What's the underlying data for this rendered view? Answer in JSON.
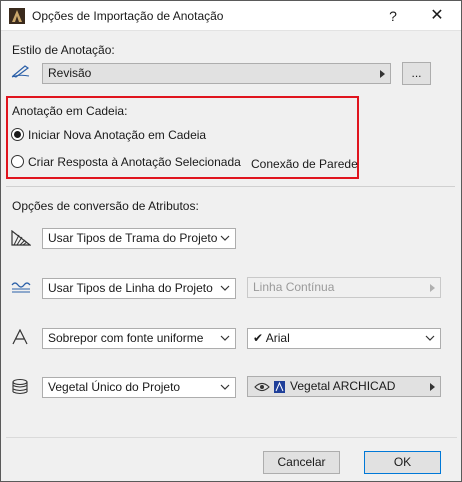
{
  "window": {
    "title": "Opções de Importação de Anotação",
    "help": "?",
    "close": "✕"
  },
  "style": {
    "label": "Estilo de Anotação:",
    "value": "Revisão",
    "more_button": "..."
  },
  "chain": {
    "label": "Anotação em Cadeia:",
    "option_new": "Iniciar Nova Anotação em Cadeia",
    "option_new_checked": true,
    "option_reply": "Criar Resposta à Anotação Selecionada",
    "option_reply_checked": false,
    "wall_connection": "Conexão de Parede"
  },
  "attributes": {
    "label": "Opções de conversão de Atributos:",
    "hatch": {
      "value": "Usar Tipos de Trama do Projeto"
    },
    "line": {
      "value": "Usar Tipos de Linha do Projeto",
      "secondary": "Linha Contínua"
    },
    "font": {
      "value": "Sobrepor com fonte uniforme",
      "checkmark": "✔",
      "font_value": "Arial"
    },
    "surface": {
      "value": "Vegetal Único do Projeto",
      "secondary": "Vegetal ARCHICAD"
    }
  },
  "footer": {
    "cancel": "Cancelar",
    "ok": "OK"
  },
  "icons": {
    "app": "archicad-app-icon",
    "style": "pen-icon",
    "hatch": "hatch-icon",
    "line": "line-type-icon",
    "font": "font-icon",
    "surface": "surface-layers-icon"
  }
}
